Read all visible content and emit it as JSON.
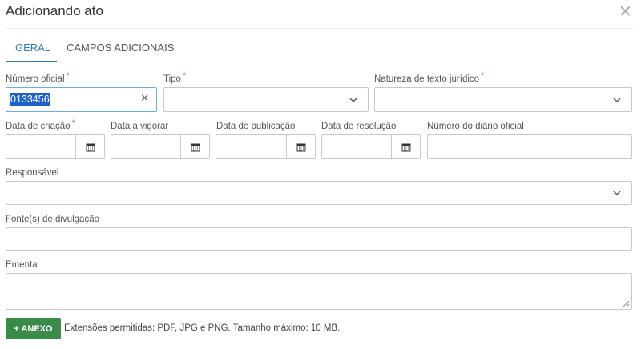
{
  "modal": {
    "title": "Adicionando ato"
  },
  "tabs": [
    {
      "label": "GERAL"
    },
    {
      "label": "CAMPOS ADICIONAIS"
    }
  ],
  "fields": {
    "numero_oficial": {
      "label": "Número oficial",
      "value": "0133456",
      "required_mark": "*"
    },
    "tipo": {
      "label": "Tipo",
      "required_mark": "*"
    },
    "natureza": {
      "label": "Natureza de texto jurídico",
      "required_mark": "*"
    },
    "data_criacao": {
      "label": "Data de criação",
      "required_mark": "*"
    },
    "data_vigorar": {
      "label": "Data a vigorar"
    },
    "data_publicacao": {
      "label": "Data de publicação"
    },
    "data_resolucao": {
      "label": "Data de resolução"
    },
    "numero_diario": {
      "label": "Número do diário oficial"
    },
    "responsavel": {
      "label": "Responsável"
    },
    "fontes": {
      "label": "Fonte(s) de divulgação"
    },
    "ementa": {
      "label": "Ementa"
    }
  },
  "attachment": {
    "button_label": "+ ANEXO",
    "note": "Extensões permitidas: PDF, JPG e PNG. Tamanho máximo: 10 MB."
  },
  "icons": {
    "close": "close-icon",
    "clear": "clear-icon",
    "dropdown": "chevron-down-icon",
    "calendar": "calendar-icon"
  },
  "colors": {
    "accent": "#337ab7",
    "required": "#d9534f",
    "button_green": "#3a8b4a",
    "selection": "#1e62c6"
  }
}
